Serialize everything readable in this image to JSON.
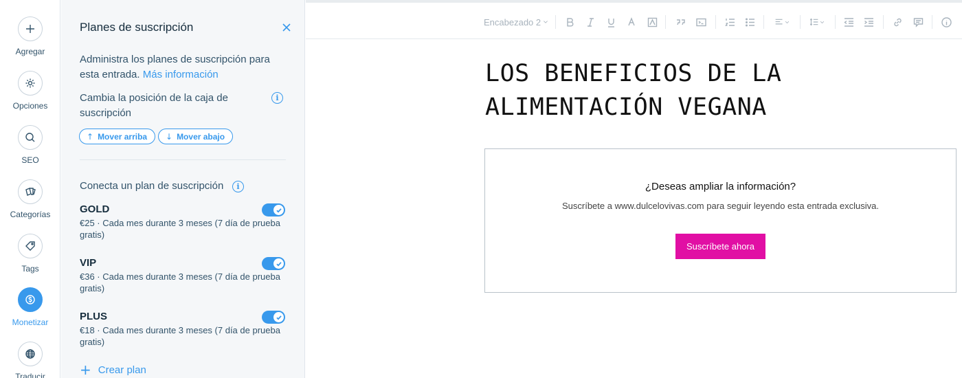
{
  "rail": {
    "items": [
      {
        "label": "Agregar",
        "icon": "plus-icon"
      },
      {
        "label": "Opciones",
        "icon": "gear-icon"
      },
      {
        "label": "SEO",
        "icon": "search-icon"
      },
      {
        "label": "Categorías",
        "icon": "cards-icon"
      },
      {
        "label": "Tags",
        "icon": "tag-icon"
      },
      {
        "label": "Monetizar",
        "icon": "dollar-icon",
        "active": true
      },
      {
        "label": "Traducir",
        "icon": "globe-icon"
      }
    ]
  },
  "panel": {
    "title": "Planes de suscripción",
    "close_icon": "close-icon",
    "intro_text": "Administra los planes de suscripción para esta entrada.",
    "intro_link": "Más información",
    "position_label": "Cambia la posición de la caja de suscripción",
    "move_up_label": "Mover arriba",
    "move_down_label": "Mover abajo",
    "connect_label": "Conecta un plan de suscripción",
    "plans": [
      {
        "name": "GOLD",
        "description": "€25 · Cada mes durante 3 meses (7 día de prueba gratis)",
        "enabled": true
      },
      {
        "name": "VIP",
        "description": "€36 · Cada mes durante 3 meses (7 día de prueba gratis)",
        "enabled": true
      },
      {
        "name": "PLUS",
        "description": "€18 · Cada mes durante 3 meses (7 día de prueba gratis)",
        "enabled": true
      }
    ],
    "create_plan_label": "Crear plan"
  },
  "toolbar": {
    "heading_select": "Encabezado 2",
    "buttons": [
      "bold-icon",
      "italic-icon",
      "underline-icon",
      "text-color-icon",
      "highlight-icon",
      "quote-icon",
      "code-block-icon",
      "numbered-list-icon",
      "bullet-list-icon",
      "align-icon",
      "line-spacing-icon",
      "indent-decrease-icon",
      "indent-increase-icon",
      "link-icon",
      "comment-icon",
      "info-icon"
    ]
  },
  "post": {
    "title": "LOS BENEFICIOS DE LA ALIMENTACIÓN VEGANA"
  },
  "subscription_box": {
    "heading": "¿Deseas ampliar la información?",
    "text": "Suscríbete a www.dulcelovivas.com para seguir leyendo esta entrada exclusiva.",
    "button_label": "Suscríbete ahora"
  },
  "colors": {
    "accent": "#3899ec",
    "subscribe_button": "#e10fa4",
    "text_dark": "#162d3d"
  }
}
